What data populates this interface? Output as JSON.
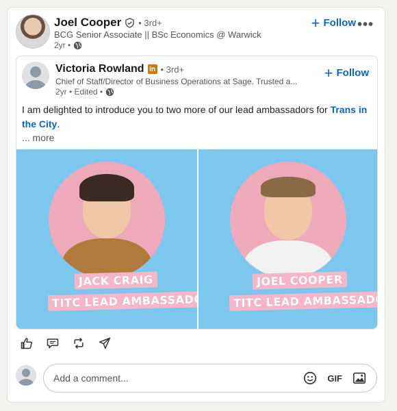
{
  "author": {
    "name": "Joel Cooper",
    "degree": "• 3rd+",
    "headline": "BCG Senior Associate || BSc Economics @ Warwick",
    "time": "2yr •",
    "follow_label": "Follow",
    "more_menu": "•••"
  },
  "shared": {
    "name": "Victoria Rowland",
    "badge": "in",
    "degree": "• 3rd+",
    "headline": "Chief of Staff/Director of Business Operations at Sage. Trusted a...",
    "time": "2yr • Edited •",
    "follow_label": "Follow",
    "text": "I am delighted to introduce you to two more of our lead ambassadors for ",
    "link": "Trans in the City",
    "text_end": ".",
    "more": "... more",
    "images": [
      {
        "name_tag": "JACK CRAIG",
        "role_tag": "TITC LEAD AMBASSADOR"
      },
      {
        "name_tag": "JOEL COOPER",
        "role_tag": "TITC LEAD AMBASSADOR"
      }
    ]
  },
  "comment": {
    "placeholder": "Add a comment...",
    "gif": "GIF"
  },
  "colors": {
    "link": "#0a66c2",
    "panel_bg": "#7cc7ee",
    "circle_bg": "#eeaabb",
    "tag_bg": "#f4b6c8"
  },
  "icons": [
    "like-icon",
    "comment-icon",
    "repost-icon",
    "send-icon",
    "emoji-icon",
    "image-icon",
    "globe-icon",
    "verified-icon"
  ]
}
